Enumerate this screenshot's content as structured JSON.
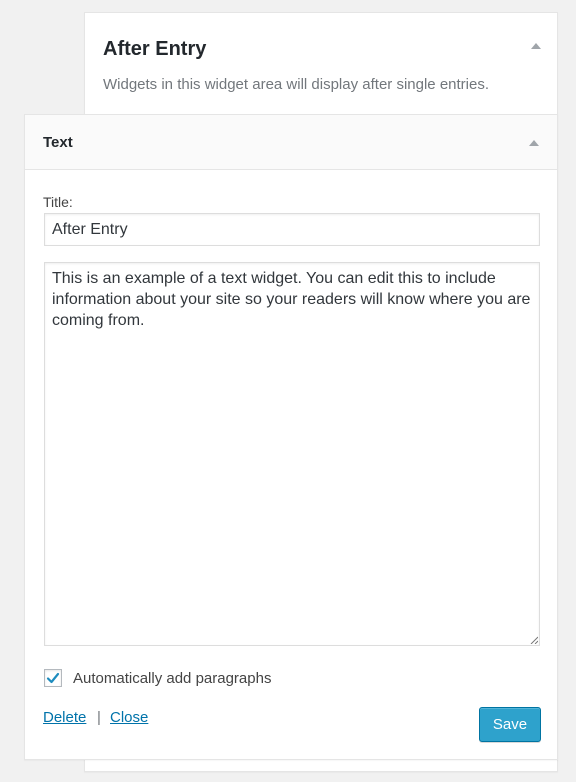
{
  "sidebar": {
    "title": "After Entry",
    "description": "Widgets in this widget area will display after single entries.",
    "toggle_icon": "arrow-up-icon"
  },
  "widget": {
    "title": "Text",
    "toggle_icon": "arrow-up-icon",
    "title_field_label": "Title:",
    "title_field_value": "After Entry",
    "content": "This is an example of a text widget. You can edit this to include information about your site so your readers will know where you are coming from.",
    "auto_paragraphs_label": "Automatically add paragraphs",
    "auto_paragraphs_checked": true,
    "delete_label": "Delete",
    "separator": "|",
    "close_label": "Close",
    "save_label": "Save"
  },
  "colors": {
    "link": "#0073aa",
    "save_button": "#2ea2cc",
    "checkmark": "#1e8cbe"
  }
}
